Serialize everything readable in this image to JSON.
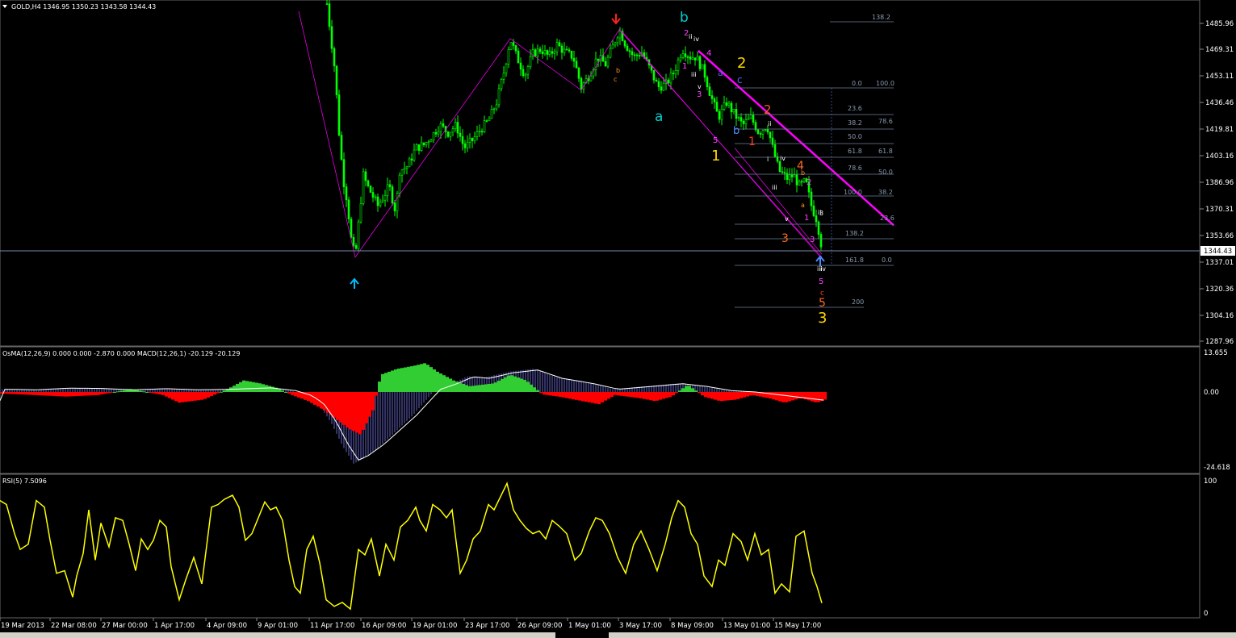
{
  "main_header": "GOLD,H4  1346.95 1350.23 1343.58 1344.43",
  "osma_header": "OsMA(12,26,9) 0.000 0.000 -2.870 0.000  MACD(12,26,1) -20.129 -20.129",
  "rsi_header": "RSI(5) 7.5096",
  "current_price": "1344.43",
  "colors": {
    "bull_candle": "#00ff00",
    "bear_candle": "#00ff00",
    "osma_up": "#32cd32",
    "osma_down": "#ff0000",
    "macd_hist": "#6464c8",
    "rsi_line": "#ffff00",
    "trendline": "#ff00ff",
    "fib": "#6e7f99"
  },
  "icons": [
    "menu-triangle-icon",
    "up-arrow-marker-icon",
    "down-arrow-marker-icon"
  ],
  "chart_data": [
    {
      "type": "candlestick",
      "title": "GOLD,H4",
      "ohlc_last": {
        "open": 1346.95,
        "high": 1350.23,
        "low": 1343.58,
        "close": 1344.43
      },
      "ylim": [
        1280,
        1500
      ],
      "y_ticks": [
        "1485.96",
        "1469.31",
        "1453.11",
        "1436.46",
        "1419.81",
        "1403.16",
        "1386.96",
        "1370.31",
        "1353.66",
        "1337.01",
        "1320.36",
        "1304.16",
        "1287.96"
      ],
      "x_ticks": [
        "19 Mar 2013",
        "22 Mar 08:00",
        "27 Mar 00:00",
        "1 Apr 17:00",
        "4 Apr 09:00",
        "9 Apr 01:00",
        "11 Apr 17:00",
        "16 Apr 09:00",
        "19 Apr 01:00",
        "23 Apr 17:00",
        "26 Apr 09:00",
        "1 May 01:00",
        "3 May 17:00",
        "8 May 09:00",
        "13 May 01:00",
        "15 May 17:00"
      ],
      "close_path": [
        [
          0,
          1530
        ],
        [
          40,
          1530
        ],
        [
          90,
          1530
        ],
        [
          130,
          1528
        ],
        [
          170,
          1526
        ],
        [
          210,
          1528
        ],
        [
          250,
          1525
        ],
        [
          290,
          1524
        ],
        [
          330,
          1520
        ],
        [
          370,
          1520
        ],
        [
          405,
          1505
        ],
        [
          415,
          1460
        ],
        [
          420,
          1420
        ],
        [
          425,
          1390
        ],
        [
          430,
          1375
        ],
        [
          435,
          1350
        ],
        [
          440,
          1338
        ],
        [
          445,
          1365
        ],
        [
          450,
          1392
        ],
        [
          455,
          1385
        ],
        [
          460,
          1380
        ],
        [
          468,
          1372
        ],
        [
          475,
          1378
        ],
        [
          482,
          1385
        ],
        [
          490,
          1368
        ],
        [
          495,
          1395
        ],
        [
          505,
          1398
        ],
        [
          515,
          1410
        ],
        [
          525,
          1412
        ],
        [
          535,
          1418
        ],
        [
          545,
          1425
        ],
        [
          555,
          1420
        ],
        [
          565,
          1425
        ],
        [
          575,
          1410
        ],
        [
          585,
          1415
        ],
        [
          595,
          1422
        ],
        [
          605,
          1428
        ],
        [
          615,
          1440
        ],
        [
          625,
          1462
        ],
        [
          632,
          1482
        ],
        [
          640,
          1470
        ],
        [
          650,
          1458
        ],
        [
          660,
          1472
        ],
        [
          670,
          1475
        ],
        [
          680,
          1470
        ],
        [
          690,
          1478
        ],
        [
          700,
          1473
        ],
        [
          710,
          1470
        ],
        [
          720,
          1450
        ],
        [
          730,
          1458
        ],
        [
          740,
          1470
        ],
        [
          750,
          1465
        ],
        [
          760,
          1478
        ],
        [
          767,
          1488
        ],
        [
          775,
          1478
        ],
        [
          785,
          1470
        ],
        [
          795,
          1473
        ],
        [
          805,
          1462
        ],
        [
          815,
          1450
        ],
        [
          825,
          1452
        ],
        [
          835,
          1460
        ],
        [
          845,
          1475
        ],
        [
          855,
          1470
        ],
        [
          862,
          1470
        ],
        [
          872,
          1460
        ],
        [
          880,
          1445
        ],
        [
          890,
          1430
        ],
        [
          900,
          1440
        ],
        [
          910,
          1432
        ],
        [
          920,
          1425
        ],
        [
          930,
          1430
        ],
        [
          940,
          1420
        ],
        [
          950,
          1425
        ],
        [
          958,
          1408
        ],
        [
          965,
          1395
        ],
        [
          975,
          1390
        ],
        [
          983,
          1392
        ],
        [
          990,
          1385
        ],
        [
          998,
          1388
        ],
        [
          1005,
          1372
        ],
        [
          1012,
          1362
        ],
        [
          1018,
          1344
        ]
      ],
      "wave_labels": [
        "b",
        "2",
        "ii",
        "iv",
        "4",
        "1",
        "iii",
        "v",
        "3",
        "2",
        "a",
        "c",
        "a",
        "b",
        "2",
        "ii",
        "5",
        "1",
        "1",
        "iv",
        "i",
        "iii",
        "4",
        "b",
        "v",
        "3",
        "a",
        "2",
        "1",
        "3",
        "ii",
        "3",
        "iii",
        "iv",
        "5",
        "c",
        "5",
        "3",
        "b",
        "c"
      ],
      "fib_levels": [
        "138.2",
        "0.0",
        "100.0",
        "23.6",
        "38.2",
        "78.6",
        "50.0",
        "61.8",
        "61.8",
        "78.6",
        "50.0",
        "100.0",
        "38.2",
        "23.6",
        "138.2",
        "161.8",
        "0.0",
        "200"
      ]
    },
    {
      "type": "bar",
      "title": "OsMA(12,26,9)",
      "series": [
        {
          "name": "OsMA",
          "values": [
            0.0,
            0.0,
            -2.87,
            0.0
          ]
        },
        {
          "name": "MACD(12,26,1)",
          "values": [
            -20.129,
            -20.129
          ]
        }
      ],
      "y_ticks": [
        "13.655",
        "0.00",
        "-24.618"
      ],
      "ylim": [
        -24.618,
        13.655
      ],
      "macd_line": [
        [
          0,
          1
        ],
        [
          40,
          0.8
        ],
        [
          80,
          1.4
        ],
        [
          120,
          1.3
        ],
        [
          160,
          0.8
        ],
        [
          200,
          1.2
        ],
        [
          240,
          0.8
        ],
        [
          280,
          1.0
        ],
        [
          330,
          1.5
        ],
        [
          360,
          0.5
        ],
        [
          380,
          -1.2
        ],
        [
          395,
          -4
        ],
        [
          410,
          -10
        ],
        [
          425,
          -18
        ],
        [
          438,
          -23.5
        ],
        [
          450,
          -22
        ],
        [
          470,
          -18
        ],
        [
          490,
          -13
        ],
        [
          510,
          -8
        ],
        [
          525,
          -3.5
        ],
        [
          540,
          1
        ],
        [
          560,
          3
        ],
        [
          580,
          5.5
        ],
        [
          600,
          5
        ],
        [
          630,
          7
        ],
        [
          660,
          8
        ],
        [
          690,
          5
        ],
        [
          730,
          3
        ],
        [
          760,
          1
        ],
        [
          800,
          2
        ],
        [
          840,
          3
        ],
        [
          870,
          2
        ],
        [
          900,
          0.5
        ],
        [
          930,
          0
        ],
        [
          960,
          -1
        ],
        [
          990,
          -2
        ],
        [
          1020,
          -3
        ]
      ],
      "osma_bars": [
        [
          0,
          -0.5
        ],
        [
          40,
          -1
        ],
        [
          80,
          -1.5
        ],
        [
          120,
          -1
        ],
        [
          160,
          1
        ],
        [
          200,
          -1
        ],
        [
          220,
          -3.5
        ],
        [
          250,
          -2.5
        ],
        [
          280,
          1
        ],
        [
          300,
          4
        ],
        [
          320,
          3
        ],
        [
          340,
          1.5
        ],
        [
          360,
          -1
        ],
        [
          380,
          -3
        ],
        [
          400,
          -6
        ],
        [
          415,
          -9
        ],
        [
          430,
          -12
        ],
        [
          445,
          -14
        ],
        [
          460,
          -6
        ],
        [
          470,
          6
        ],
        [
          490,
          8
        ],
        [
          510,
          9
        ],
        [
          525,
          10
        ],
        [
          540,
          7
        ],
        [
          560,
          4
        ],
        [
          580,
          2
        ],
        [
          610,
          3
        ],
        [
          630,
          6
        ],
        [
          650,
          4
        ],
        [
          670,
          -0.8
        ],
        [
          690,
          -1.5
        ],
        [
          720,
          -3
        ],
        [
          740,
          -4
        ],
        [
          760,
          -1
        ],
        [
          790,
          -2
        ],
        [
          810,
          -3
        ],
        [
          830,
          -1.5
        ],
        [
          850,
          2.5
        ],
        [
          870,
          -1.5
        ],
        [
          890,
          -3
        ],
        [
          910,
          -2.5
        ],
        [
          930,
          -1
        ],
        [
          950,
          -2
        ],
        [
          970,
          -3.5
        ],
        [
          990,
          -2
        ],
        [
          1010,
          -3.5
        ],
        [
          1020,
          -2.5
        ]
      ]
    },
    {
      "type": "line",
      "title": "RSI(5)",
      "series": [
        {
          "name": "RSI(5)",
          "values": [
            7.5096
          ]
        }
      ],
      "y_ticks": [
        "100",
        "0"
      ],
      "ylim": [
        0,
        100
      ],
      "points": [
        [
          0,
          85
        ],
        [
          8,
          82
        ],
        [
          18,
          60
        ],
        [
          25,
          48
        ],
        [
          35,
          52
        ],
        [
          45,
          85
        ],
        [
          55,
          80
        ],
        [
          62,
          55
        ],
        [
          70,
          30
        ],
        [
          80,
          32
        ],
        [
          90,
          12
        ],
        [
          95,
          28
        ],
        [
          103,
          45
        ],
        [
          110,
          78
        ],
        [
          118,
          40
        ],
        [
          125,
          68
        ],
        [
          135,
          50
        ],
        [
          143,
          72
        ],
        [
          152,
          70
        ],
        [
          160,
          52
        ],
        [
          168,
          32
        ],
        [
          175,
          56
        ],
        [
          183,
          48
        ],
        [
          190,
          55
        ],
        [
          198,
          70
        ],
        [
          206,
          65
        ],
        [
          212,
          35
        ],
        [
          222,
          10
        ],
        [
          230,
          25
        ],
        [
          240,
          42
        ],
        [
          250,
          22
        ],
        [
          262,
          80
        ],
        [
          270,
          82
        ],
        [
          278,
          86
        ],
        [
          288,
          89
        ],
        [
          296,
          80
        ],
        [
          304,
          55
        ],
        [
          312,
          60
        ],
        [
          320,
          72
        ],
        [
          328,
          84
        ],
        [
          335,
          78
        ],
        [
          342,
          80
        ],
        [
          350,
          70
        ],
        [
          358,
          40
        ],
        [
          365,
          20
        ],
        [
          372,
          15
        ],
        [
          380,
          48
        ],
        [
          388,
          58
        ],
        [
          396,
          38
        ],
        [
          404,
          10
        ],
        [
          414,
          5
        ],
        [
          424,
          8
        ],
        [
          434,
          3
        ],
        [
          444,
          48
        ],
        [
          452,
          44
        ],
        [
          460,
          56
        ],
        [
          470,
          28
        ],
        [
          478,
          52
        ],
        [
          488,
          40
        ],
        [
          496,
          65
        ],
        [
          505,
          70
        ],
        [
          515,
          80
        ],
        [
          520,
          70
        ],
        [
          528,
          62
        ],
        [
          536,
          82
        ],
        [
          545,
          78
        ],
        [
          553,
          72
        ],
        [
          560,
          78
        ],
        [
          570,
          30
        ],
        [
          578,
          40
        ],
        [
          586,
          56
        ],
        [
          595,
          62
        ],
        [
          605,
          82
        ],
        [
          612,
          78
        ],
        [
          620,
          88
        ],
        [
          628,
          98
        ],
        [
          636,
          78
        ],
        [
          644,
          70
        ],
        [
          652,
          64
        ],
        [
          660,
          60
        ],
        [
          668,
          62
        ],
        [
          676,
          56
        ],
        [
          684,
          70
        ],
        [
          692,
          66
        ],
        [
          702,
          60
        ],
        [
          712,
          40
        ],
        [
          720,
          45
        ],
        [
          730,
          62
        ],
        [
          738,
          72
        ],
        [
          746,
          70
        ],
        [
          755,
          60
        ],
        [
          765,
          42
        ],
        [
          775,
          30
        ],
        [
          785,
          52
        ],
        [
          794,
          62
        ],
        [
          804,
          48
        ],
        [
          814,
          32
        ],
        [
          824,
          52
        ],
        [
          832,
          72
        ],
        [
          840,
          85
        ],
        [
          848,
          80
        ],
        [
          856,
          60
        ],
        [
          864,
          52
        ],
        [
          872,
          28
        ],
        [
          882,
          20
        ],
        [
          890,
          40
        ],
        [
          898,
          36
        ],
        [
          908,
          60
        ],
        [
          918,
          54
        ],
        [
          926,
          40
        ],
        [
          935,
          60
        ],
        [
          943,
          44
        ],
        [
          952,
          48
        ],
        [
          960,
          15
        ],
        [
          968,
          22
        ],
        [
          978,
          16
        ],
        [
          986,
          58
        ],
        [
          996,
          62
        ],
        [
          1006,
          30
        ],
        [
          1012,
          20
        ],
        [
          1018,
          7.5
        ]
      ]
    }
  ]
}
